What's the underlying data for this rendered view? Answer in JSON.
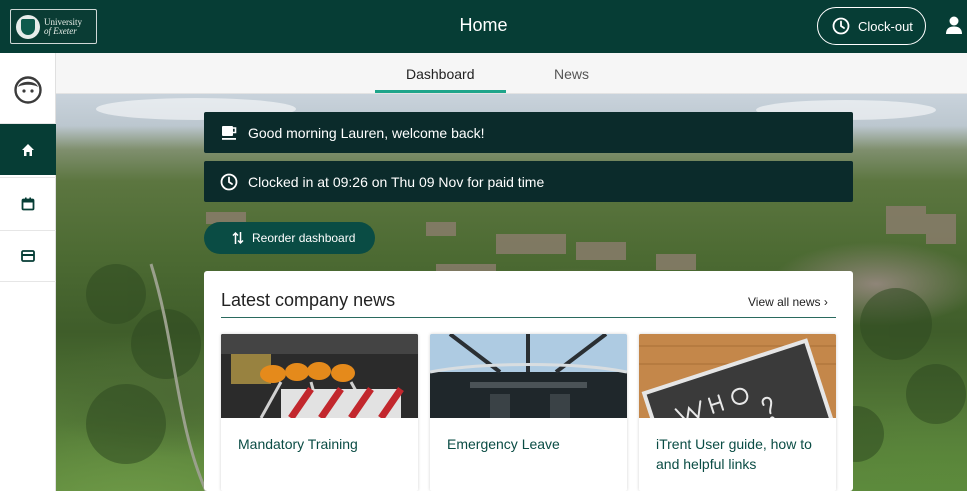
{
  "header": {
    "logo_text_line1": "University",
    "logo_text_line2": "of Exeter",
    "title": "Home",
    "clock_button_label": "Clock-out"
  },
  "sidebar": {
    "items": [
      {
        "name": "home",
        "icon": "home-icon",
        "active": true
      },
      {
        "name": "calendar",
        "icon": "calendar-icon",
        "active": false
      },
      {
        "name": "payslip",
        "icon": "card-icon",
        "active": false
      }
    ]
  },
  "tabs": [
    {
      "label": "Dashboard",
      "active": true
    },
    {
      "label": "News",
      "active": false
    }
  ],
  "greeting": {
    "message": "Good morning Lauren, welcome back!",
    "clock_status": "Clocked in at 09:26 on Thu 09 Nov for paid time"
  },
  "reorder_button_label": "Reorder dashboard",
  "news": {
    "heading": "Latest company news",
    "view_all": "View all news  ›",
    "items": [
      {
        "title": "Mandatory Training"
      },
      {
        "title": "Emergency Leave"
      },
      {
        "title": "iTrent User guide, how to and helpful links"
      }
    ]
  },
  "colors": {
    "brand_dark_green": "#063d35",
    "accent_teal": "#1fa58b",
    "banner_bg": "#0b2b2b"
  }
}
